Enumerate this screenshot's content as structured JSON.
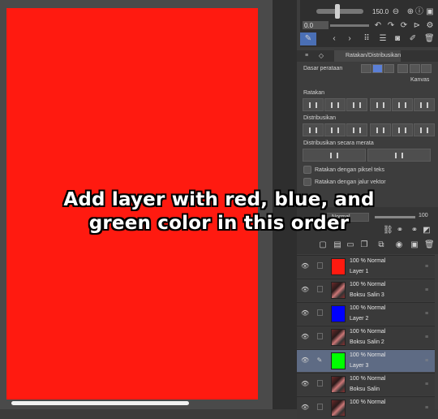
{
  "canvas": {
    "color": "#ff1a10"
  },
  "top_toolbar": {
    "brush_size": "150.0",
    "opacity": "0.0"
  },
  "panel_tabs": {
    "active": "Ratakan/Distribusikan"
  },
  "align_panel": {
    "base_label": "Dasar perataan",
    "base_value": "Kanvas",
    "align_label": "Ratakan",
    "distribute_label": "Distribusikan",
    "distribute_evenly_label": "Distribusikan secara merata",
    "checkbox_pixel": "Ratakan dengan piksel teks",
    "checkbox_vector": "Ratakan dengan jalur vektor"
  },
  "layer_panel": {
    "blend_mode": "Normal",
    "opacity": "100",
    "layers": [
      {
        "mode": "100 % Normal",
        "name": "Layer 1",
        "color": "#ff1a10",
        "type": "color"
      },
      {
        "mode": "100 % Normal",
        "name": "Boksu Salin 3",
        "type": "photo"
      },
      {
        "mode": "100 % Normal",
        "name": "Layer 2",
        "color": "#0000ff",
        "type": "color"
      },
      {
        "mode": "100 % Normal",
        "name": "Boksu Salin 2",
        "type": "photo"
      },
      {
        "mode": "100 % Normal",
        "name": "Layer 3",
        "color": "#00ff00",
        "type": "color",
        "selected": true
      },
      {
        "mode": "100 % Normal",
        "name": "Boksu Salin",
        "type": "photo"
      },
      {
        "mode": "100 % Normal",
        "name": "",
        "type": "photo"
      }
    ]
  },
  "overlay": {
    "line1": "Add layer with red, blue, and",
    "line2": "green color in this order"
  }
}
